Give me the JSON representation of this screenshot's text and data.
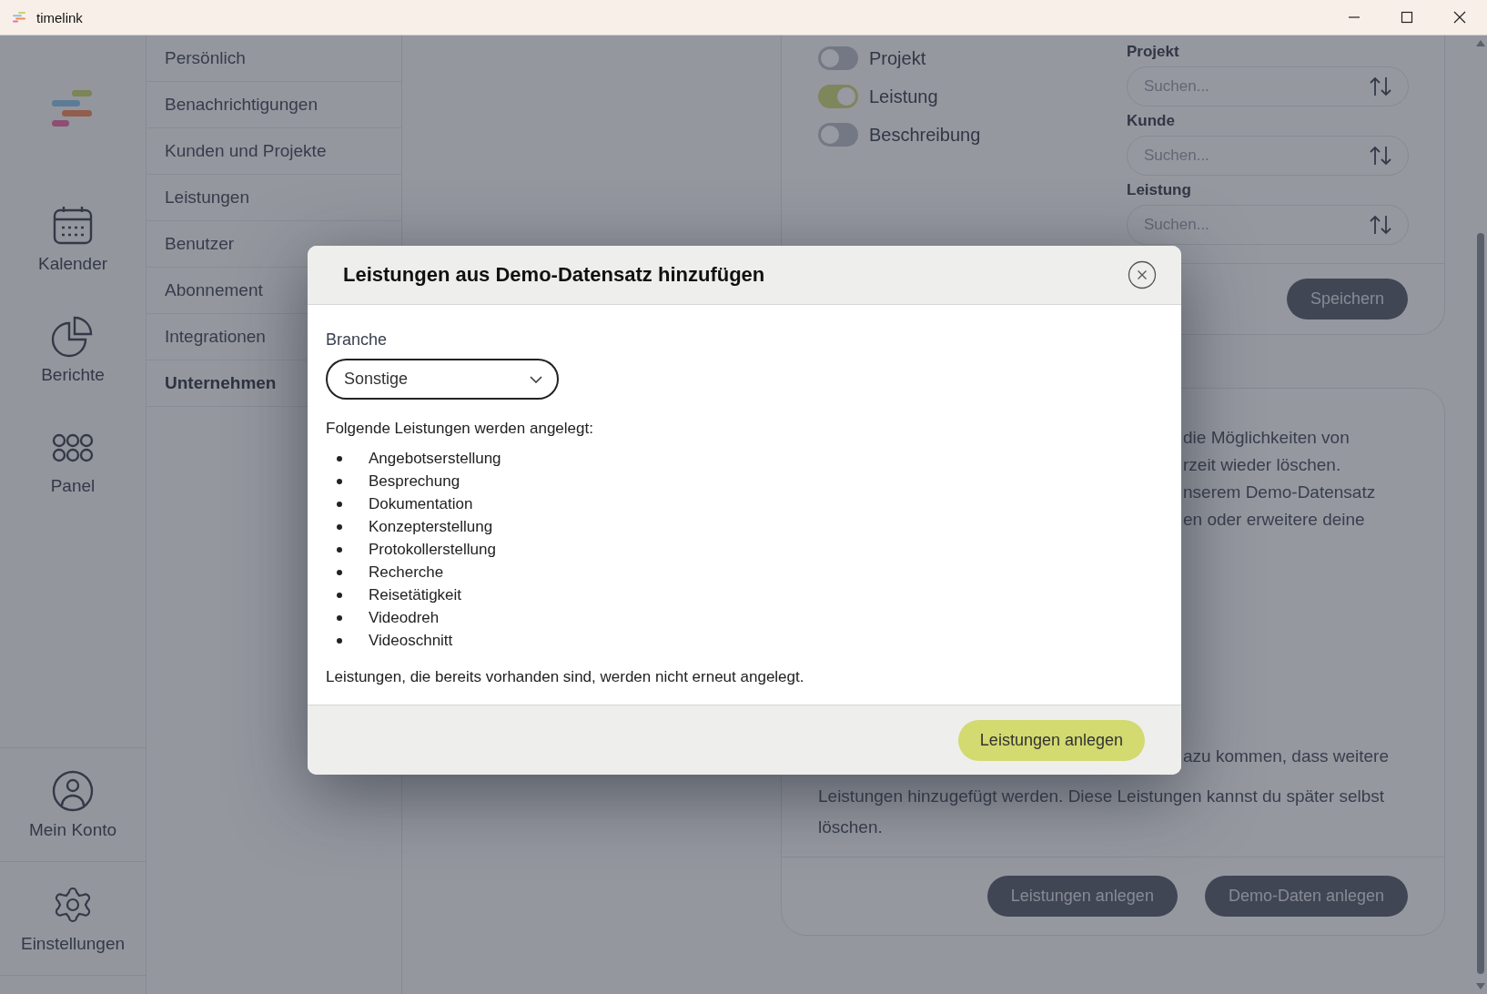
{
  "window": {
    "title": "timelink"
  },
  "rail": {
    "top": [
      {
        "label": "Kalender",
        "kind": "calendar"
      },
      {
        "label": "Berichte",
        "kind": "chart"
      },
      {
        "label": "Panel",
        "kind": "grid"
      }
    ],
    "bottom": [
      {
        "label": "Mein Konto",
        "kind": "account"
      },
      {
        "label": "Einstellungen",
        "kind": "settings"
      }
    ]
  },
  "settings_nav": [
    {
      "label": "Persönlich",
      "selected": false
    },
    {
      "label": "Benachrichtigungen",
      "selected": false
    },
    {
      "label": "Kunden und Projekte",
      "selected": false
    },
    {
      "label": "Leistungen",
      "selected": false
    },
    {
      "label": "Benutzer",
      "selected": false
    },
    {
      "label": "Abonnement",
      "selected": false
    },
    {
      "label": "Integrationen",
      "selected": false
    },
    {
      "label": "Unternehmen",
      "selected": true
    }
  ],
  "top_card": {
    "toggles": [
      {
        "label": "Projekt",
        "on": false
      },
      {
        "label": "Leistung",
        "on": true
      },
      {
        "label": "Beschreibung",
        "on": false
      }
    ],
    "filters": [
      {
        "label": "Projekt",
        "placeholder": "Suchen..."
      },
      {
        "label": "Kunde",
        "placeholder": "Suchen..."
      },
      {
        "label": "Leistung",
        "placeholder": "Suchen..."
      }
    ],
    "save_button": "Speichern"
  },
  "info_card": {
    "upper_lines": [
      "die Möglichkeiten von",
      "rzeit wieder löschen.",
      "nserem Demo-Datensatz",
      "en oder erweitere deine"
    ],
    "lower_lines": [
      "azu kommen, dass weitere",
      "Leistungen hinzugefügt werden. Diese Leistungen kannst du später selbst",
      "löschen."
    ],
    "buttons": [
      "Leistungen anlegen",
      "Demo-Daten anlegen"
    ]
  },
  "modal": {
    "title": "Leistungen aus Demo-Datensatz hinzufügen",
    "field_label": "Branche",
    "select_value": "Sonstige",
    "intro": "Folgende Leistungen werden angelegt:",
    "items": [
      "Angebotserstellung",
      "Besprechung",
      "Dokumentation",
      "Konzepterstellung",
      "Protokollerstellung",
      "Recherche",
      "Reisetätigkeit",
      "Videodreh",
      "Videoschnitt"
    ],
    "note": "Leistungen, die bereits vorhanden sind, werden nicht erneut angelegt.",
    "confirm_button": "Leistungen anlegen"
  }
}
